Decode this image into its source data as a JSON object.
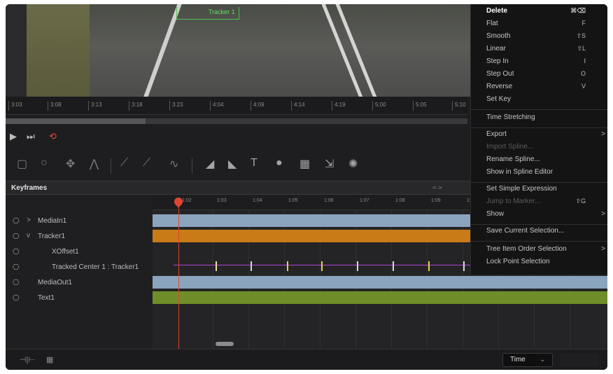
{
  "viewer": {
    "tracker_label": "Tracker 1",
    "ruler_ticks": [
      "3:03",
      "3:08",
      "3:13",
      "3:18",
      "3:23",
      "4:04",
      "4:09",
      "4:14",
      "4:19",
      "5:00",
      "5:05",
      "5:10"
    ]
  },
  "transport": {
    "play_icon": "play-icon",
    "skip_icon": "skip-end-icon",
    "loop_icon": "loop-icon"
  },
  "keyframes": {
    "title": "Keyframes",
    "nav_arrows": "<·>",
    "timeline_ticks": [
      "1:02",
      "1:03",
      "1:04",
      "1:05",
      "1:06",
      "1:07",
      "1:08",
      "1:09",
      "1:"
    ],
    "tree": [
      {
        "name": "MediaIn1",
        "chevron": ">",
        "indent": 0
      },
      {
        "name": "Tracker1",
        "chevron": "v",
        "indent": 0
      },
      {
        "name": "XOffset1",
        "chevron": "",
        "indent": 1
      },
      {
        "name": "Tracked Center 1 : Tracker1",
        "chevron": "",
        "indent": 1
      },
      {
        "name": "MediaOut1",
        "chevron": "",
        "indent": 0
      },
      {
        "name": "Text1",
        "chevron": "",
        "indent": 0
      }
    ]
  },
  "bottom": {
    "time_select_value": "Time",
    "fit_icon": "fit-width-icon",
    "grid_icon": "spreadsheet-icon"
  },
  "context_menu": {
    "items": [
      {
        "label": "Delete",
        "shortcut": "⌘⌫",
        "style": "bold"
      },
      {
        "label": "Flat",
        "shortcut": "F",
        "style": "normal"
      },
      {
        "label": "Smooth",
        "shortcut": "⇧S",
        "style": "normal"
      },
      {
        "label": "Linear",
        "shortcut": "⇧L",
        "style": "normal"
      },
      {
        "label": "Step In",
        "shortcut": "I",
        "style": "normal"
      },
      {
        "label": "Step Out",
        "shortcut": "O",
        "style": "normal"
      },
      {
        "label": "Reverse",
        "shortcut": "V",
        "style": "normal"
      },
      {
        "label": "Set Key",
        "shortcut": "",
        "style": "normal"
      },
      {
        "label": "Time Stretching",
        "shortcut": "",
        "style": "normal"
      },
      {
        "label": "Export",
        "shortcut": "",
        "style": "normal",
        "submenu": ">"
      },
      {
        "label": "Import Spline...",
        "shortcut": "",
        "style": "dim"
      },
      {
        "label": "Rename Spline...",
        "shortcut": "",
        "style": "normal"
      },
      {
        "label": "Show in Spline Editor",
        "shortcut": "",
        "style": "normal"
      },
      {
        "label": "Set Simple Expression",
        "shortcut": "",
        "style": "normal"
      },
      {
        "label": "Jump to Marker...",
        "shortcut": "⇧G",
        "style": "dim"
      },
      {
        "label": "Show",
        "shortcut": "",
        "style": "normal",
        "submenu": ">"
      },
      {
        "label": "Save Current Selection...",
        "shortcut": "",
        "style": "normal"
      },
      {
        "label": "Tree Item Order Selection",
        "shortcut": "",
        "style": "normal",
        "submenu": ">"
      },
      {
        "label": "Lock Point Selection",
        "shortcut": "",
        "style": "normal"
      }
    ]
  },
  "colors": {
    "playhead": "#e0452f",
    "keyframe_line": "#b23fd6",
    "bar_blue": "#8aa4bd",
    "bar_orange": "#c97b17",
    "bar_green": "#6f8e2a"
  }
}
